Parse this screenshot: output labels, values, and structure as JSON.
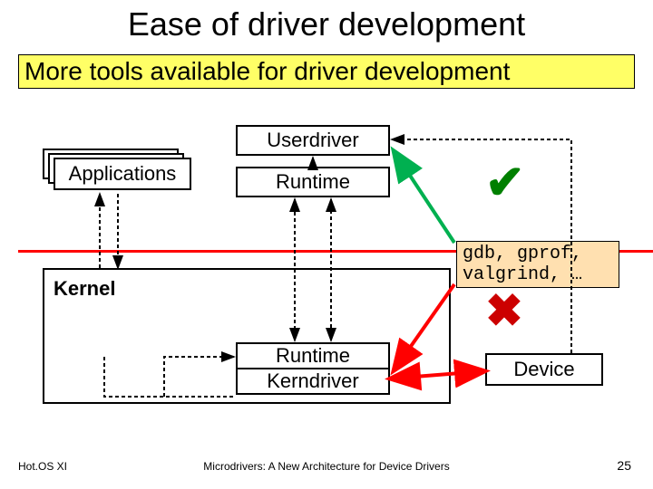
{
  "title": "Ease of driver development",
  "subtitle": "More tools available for driver development",
  "boxes": {
    "applications": "Applications",
    "userdriver": "Userdriver",
    "runtime_top": "Runtime",
    "runtime_bottom": "Runtime",
    "kerndriver": "Kerndriver",
    "kernel_label": "Kernel",
    "device": "Device"
  },
  "tools_label": "gdb, gprof, valgrind, …",
  "marks": {
    "check": "✔",
    "cross": "✖"
  },
  "footer": {
    "left": "Hot.OS XI",
    "mid": "Microdrivers: A New Architecture for Device Drivers",
    "right": "25"
  },
  "colors": {
    "highlight_bg": "#ffff66",
    "tools_bg": "#ffe0b0",
    "divider": "#ff0000",
    "ok": "#008000",
    "no": "#cc0000",
    "green_arrow": "#00b050",
    "red_arrow": "#ff0000"
  }
}
